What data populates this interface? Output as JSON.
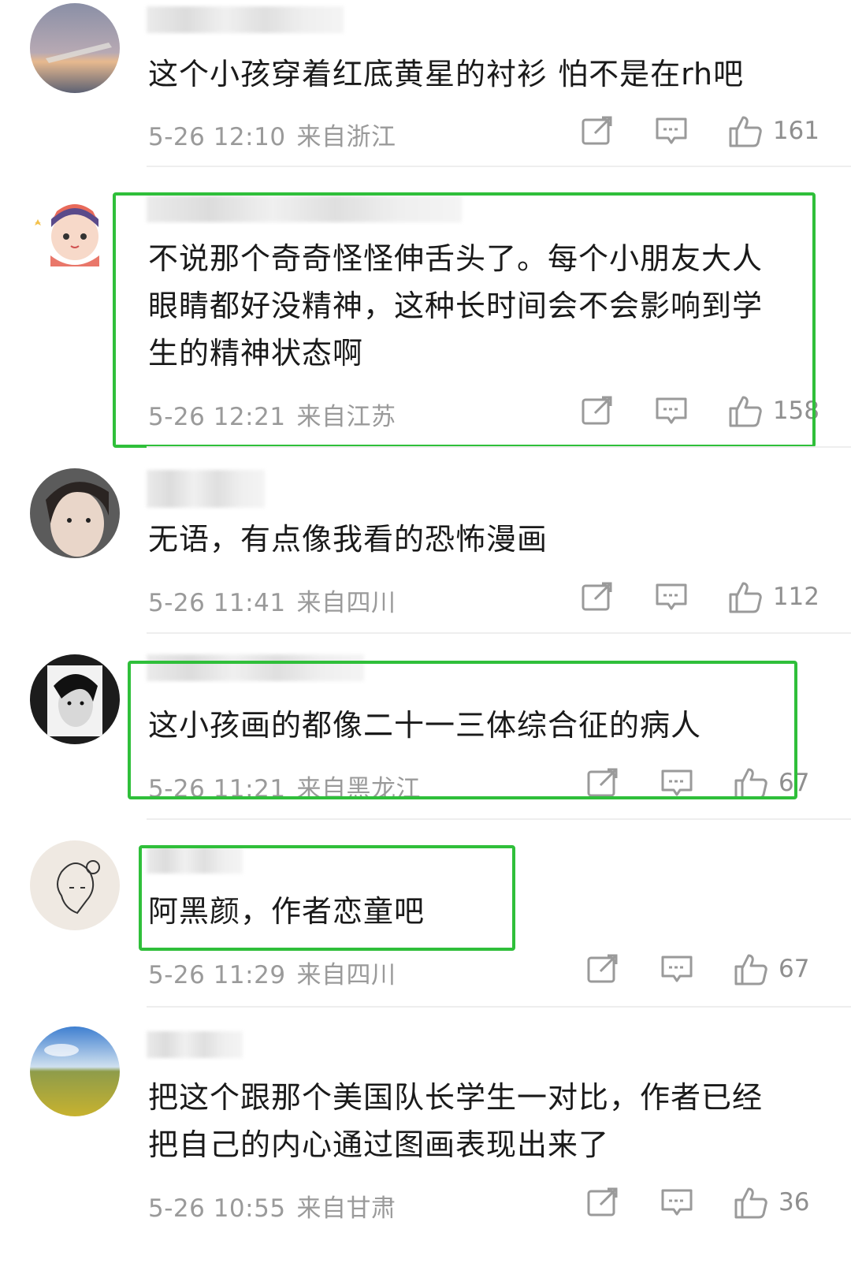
{
  "colors": {
    "highlight": "#2fbf3a",
    "text": "#1a1a1a",
    "meta": "#9a9a9a"
  },
  "comments": [
    {
      "text_lines": [
        "这个小孩穿着红底黄星的衬衫 怕不是在rh吧"
      ],
      "date": "5-26 12:10",
      "location": "来自浙江",
      "likes": "161"
    },
    {
      "text_lines": [
        "不说那个奇奇怪怪伸舌头了。每个小朋友大人",
        "眼睛都好没精神，这种长时间会不会影响到学",
        "生的精神状态啊"
      ],
      "date": "5-26 12:21",
      "location": "来自江苏",
      "likes": "158"
    },
    {
      "text_lines": [
        "无语，有点像我看的恐怖漫画"
      ],
      "date": "5-26 11:41",
      "location": "来自四川",
      "likes": "112"
    },
    {
      "text_lines": [
        "这小孩画的都像二十一三体综合征的病人"
      ],
      "date": "5-26 11:21",
      "location": "来自黑龙江",
      "likes": "67"
    },
    {
      "text_lines": [
        "阿黑颜，作者恋童吧"
      ],
      "date": "5-26 11:29",
      "location": "来自四川",
      "likes": "67"
    },
    {
      "text_lines": [
        "把这个跟那个美国队长学生一对比，作者已经",
        "把自己的内心通过图画表现出来了"
      ],
      "date": "5-26 10:55",
      "location": "来自甘肃",
      "likes": "36"
    }
  ],
  "icons": {
    "share": "share-icon",
    "reply": "comment-icon",
    "like": "thumbs-up-icon"
  }
}
